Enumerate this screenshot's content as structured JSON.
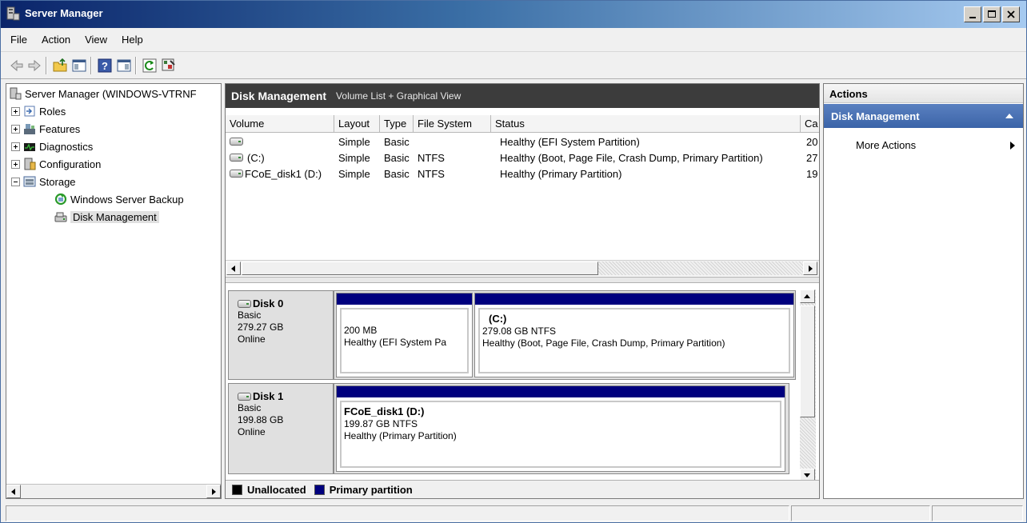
{
  "window": {
    "title": "Server Manager"
  },
  "menu": {
    "items": [
      "File",
      "Action",
      "View",
      "Help"
    ]
  },
  "tree": {
    "root": "Server Manager (WINDOWS-VTRNF",
    "items": [
      {
        "label": "Roles"
      },
      {
        "label": "Features"
      },
      {
        "label": "Diagnostics"
      },
      {
        "label": "Configuration"
      },
      {
        "label": "Storage"
      },
      {
        "label": "Windows Server Backup"
      },
      {
        "label": "Disk Management"
      }
    ]
  },
  "center": {
    "title": "Disk Management",
    "view": "Volume List + Graphical View",
    "columns": [
      "Volume",
      "Layout",
      "Type",
      "File System",
      "Status",
      "Ca"
    ],
    "rows": [
      {
        "volume": "",
        "layout": "Simple",
        "type": "Basic",
        "fs": "",
        "status": "Healthy (EFI System Partition)",
        "cap": "20"
      },
      {
        "volume": "(C:)",
        "layout": "Simple",
        "type": "Basic",
        "fs": "NTFS",
        "status": "Healthy (Boot, Page File, Crash Dump, Primary Partition)",
        "cap": "27"
      },
      {
        "volume": "FCoE_disk1 (D:)",
        "layout": "Simple",
        "type": "Basic",
        "fs": "NTFS",
        "status": "Healthy (Primary Partition)",
        "cap": "19"
      }
    ]
  },
  "disks": [
    {
      "name": "Disk 0",
      "type": "Basic",
      "size": "279.27 GB",
      "state": "Online",
      "partitions": [
        {
          "name": "",
          "size": "200 MB",
          "status": "Healthy (EFI System Pa"
        },
        {
          "name": "(C:)",
          "size": "279.08 GB NTFS",
          "status": "Healthy (Boot, Page File, Crash Dump, Primary Partition)"
        }
      ]
    },
    {
      "name": "Disk 1",
      "type": "Basic",
      "size": "199.88 GB",
      "state": "Online",
      "partitions": [
        {
          "name": "FCoE_disk1  (D:)",
          "size": "199.87 GB NTFS",
          "status": "Healthy (Primary Partition)"
        }
      ]
    }
  ],
  "legend": {
    "unallocated": "Unallocated",
    "primary": "Primary partition",
    "unallocated_color": "#000000",
    "primary_color": "#00007e"
  },
  "actions": {
    "header": "Actions",
    "section": "Disk Management",
    "more": "More Actions"
  },
  "icons": [
    "back-arrow-icon",
    "forward-arrow-icon",
    "up-folder-icon",
    "show-hide-tree-icon",
    "help-icon",
    "show-action-pane-icon",
    "refresh-icon",
    "properties-icon"
  ]
}
